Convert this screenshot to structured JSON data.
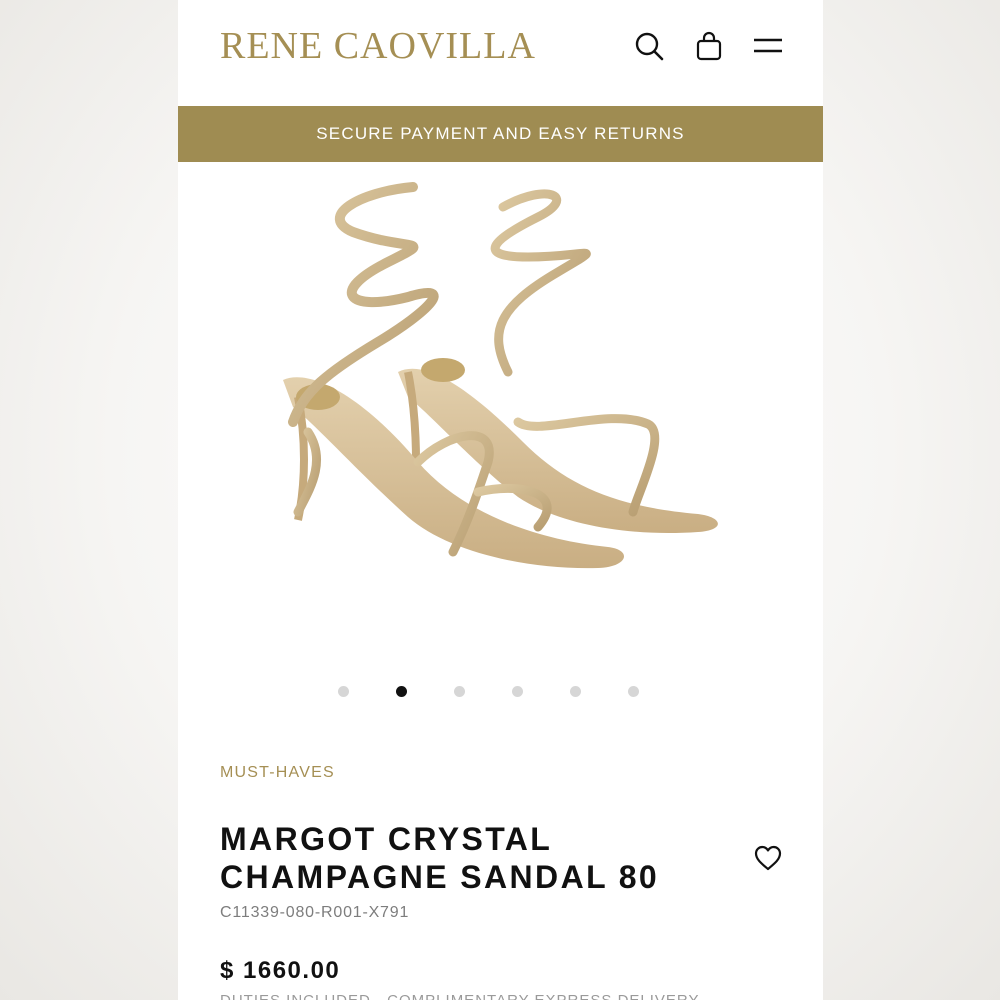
{
  "header": {
    "brand": "RENE CAOVILLA",
    "icons": [
      "search-icon",
      "shopping-bag-icon",
      "menu-icon"
    ]
  },
  "banner": {
    "text": "SECURE PAYMENT AND EASY RETURNS",
    "color": "#9f8c52"
  },
  "gallery": {
    "slide_count": 6,
    "active_slide": 2
  },
  "product": {
    "category": "MUST-HAVES",
    "title_line1": "MARGOT CRYSTAL",
    "title_line2": "CHAMPAGNE SANDAL 80",
    "sku": "C11339-080-R001-X791",
    "price": "$ 1660.00",
    "duties": "DUTIES INCLUDED · COMPLIMENTARY EXPRESS DELIVERY"
  },
  "colors": {
    "brand_gold": "#a58f54",
    "accent_gold": "#9f8c52",
    "text": "#111111"
  }
}
